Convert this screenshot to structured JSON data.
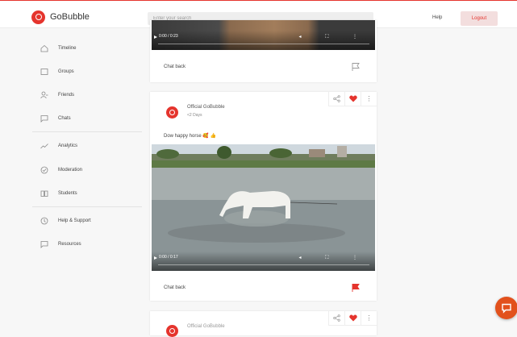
{
  "header": {
    "brand": "GoBubble",
    "search_placeholder": "Enter your search",
    "help_label": "Help",
    "logout_label": "Logout"
  },
  "sidebar": {
    "items": [
      {
        "label": "Timeline",
        "icon": "home-icon"
      },
      {
        "label": "Groups",
        "icon": "groups-icon"
      },
      {
        "label": "Friends",
        "icon": "friends-icon"
      },
      {
        "label": "Chats",
        "icon": "chat-icon"
      },
      {
        "label": "Analytics",
        "icon": "analytics-icon"
      },
      {
        "label": "Moderation",
        "icon": "moderation-icon"
      },
      {
        "label": "Students",
        "icon": "students-icon"
      },
      {
        "label": "Help & Support",
        "icon": "help-icon"
      },
      {
        "label": "Resources",
        "icon": "resources-icon"
      }
    ]
  },
  "posts": [
    {
      "video_time": "0:00 / 0:23",
      "chat_label": "Chat back",
      "flagged": false
    },
    {
      "author": "Official GoBubble",
      "time": "<2 Days",
      "caption": "Dow happy horse 🥰 👍",
      "video_time": "0:00 / 0:17",
      "chat_label": "Chat back",
      "liked": true,
      "flagged": true
    },
    {
      "author": "Official GoBubble",
      "liked": true
    }
  ],
  "colors": {
    "brand": "#e5342d",
    "fab": "#e2511c"
  }
}
